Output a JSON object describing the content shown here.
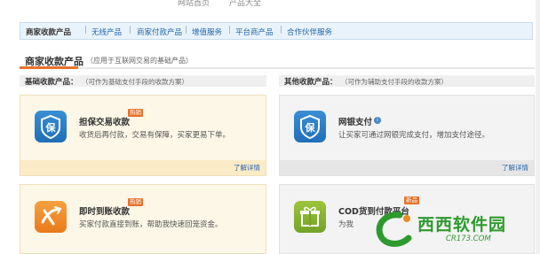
{
  "top_bar": {
    "left_text": "网站首页",
    "right_text": "产品大全"
  },
  "nav": {
    "items": [
      {
        "label": "商家收款产品"
      },
      {
        "label": "无线产品"
      },
      {
        "label": "商家付款产品"
      },
      {
        "label": "增值服务"
      },
      {
        "label": "平台商产品"
      },
      {
        "label": "合作伙伴服务"
      }
    ]
  },
  "section": {
    "title": "商家收款产品",
    "subtitle": "（应用于互联网交易的基础产品）"
  },
  "categories": {
    "basic": {
      "title": "基础收款产品：",
      "desc": "（可作为基础支付手段的收款方案）"
    },
    "other": {
      "title": "其他收款产品：",
      "desc": "（可作为辅助支付手段的收款方案）"
    }
  },
  "cards": {
    "escrow": {
      "title": "担保交易收款",
      "badge": "热销",
      "desc": "收货后再付款，交易有保障，买家更易下单。",
      "more": "了解详情",
      "icon_char": "保"
    },
    "bank": {
      "title": "网银支付",
      "desc": "让买家可通过网银完成支付，增加支付途径。",
      "more": "了解详情",
      "icon_char": "保"
    },
    "instant": {
      "title": "即时到账收款",
      "badge": "热销",
      "desc": "买家付款直接到账，帮助我快速回笼资金。"
    },
    "cod": {
      "title": "COD货到付款平台",
      "badge": "新品",
      "desc": "为我"
    }
  },
  "watermark": {
    "brand": "西西软件园",
    "url": "CR173.COM"
  },
  "colors": {
    "accent": "#e8732d",
    "link": "#2266aa",
    "nav_bg": "#e9f3fb",
    "blue_icon": "#1f6fb8",
    "orange_icon": "#f08a24",
    "green_icon": "#7fae2c",
    "watermark": "#2e9a2e"
  }
}
